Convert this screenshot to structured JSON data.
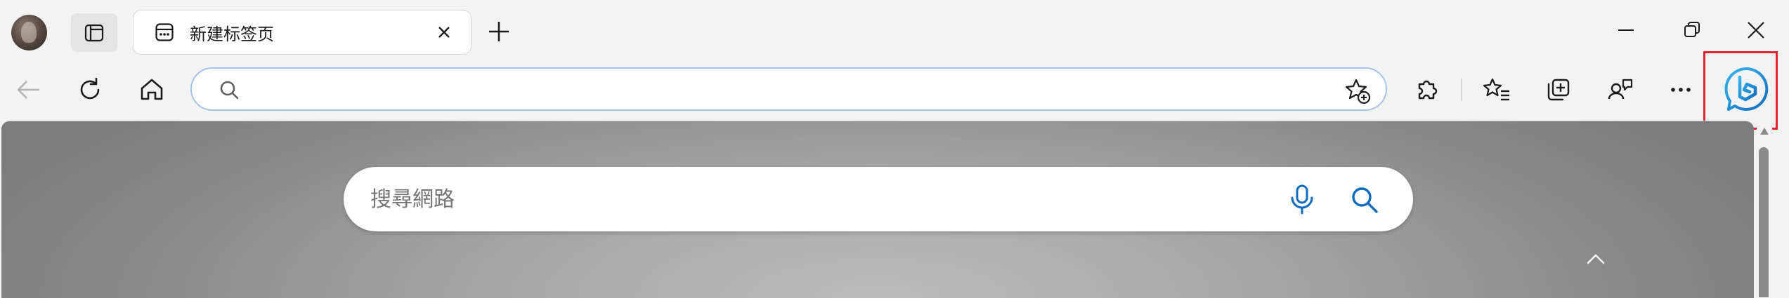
{
  "window": {
    "tab": {
      "title": "新建标签页"
    }
  },
  "address_bar": {
    "value": "",
    "placeholder": ""
  },
  "new_tab_page": {
    "search": {
      "placeholder": "搜尋網路"
    }
  },
  "colors": {
    "accent": "#0f6cbd",
    "highlight_box": "#e3242b",
    "address_border": "#a4c3ec"
  },
  "icons": {
    "title_bar": [
      "avatar",
      "tab-actions-icon",
      "tab-favicon-icon",
      "close-icon",
      "plus-icon",
      "minimize-icon",
      "restore-icon",
      "close-window-icon"
    ],
    "toolbar": [
      "back-arrow-icon",
      "refresh-icon",
      "home-icon",
      "search-icon",
      "add-favorite-icon",
      "extensions-icon",
      "favorites-icon",
      "collections-icon",
      "profile-icon",
      "more-icon",
      "copilot-icon"
    ],
    "content": [
      "microphone-icon",
      "search-icon",
      "chevron-up-icon"
    ]
  }
}
